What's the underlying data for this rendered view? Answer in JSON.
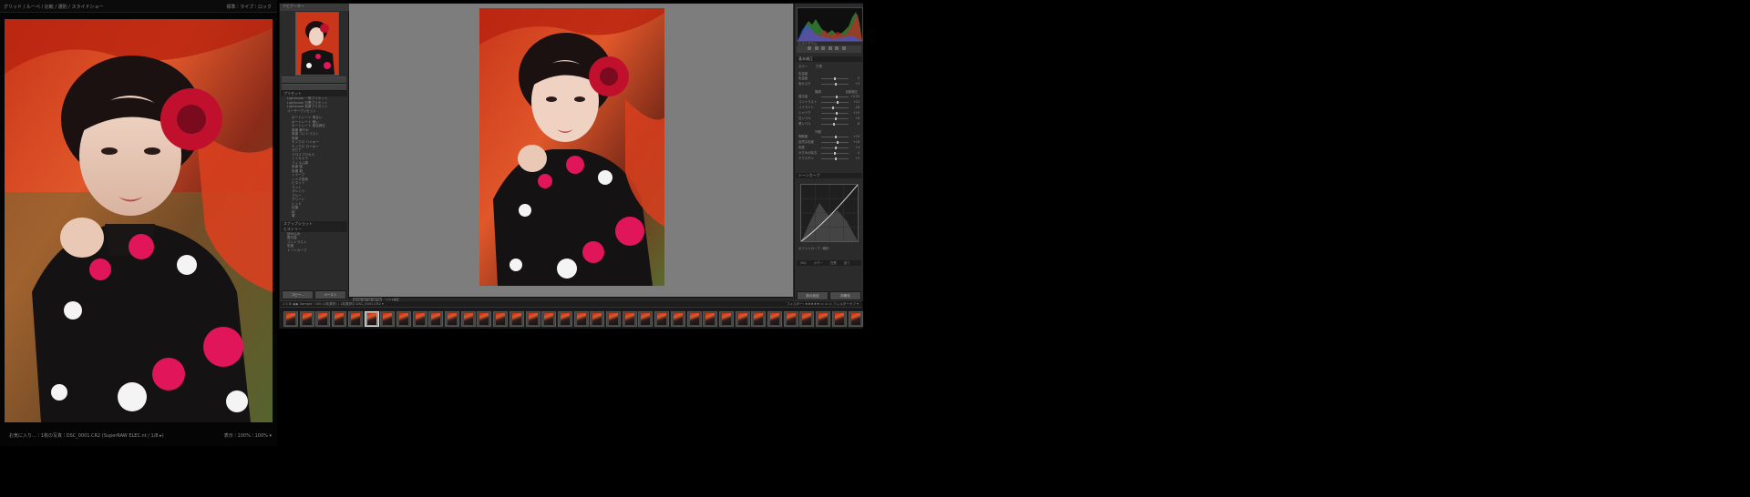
{
  "secondary": {
    "top_left": "グリッド / ルーペ / 比較 / 選別 / スライドショー",
    "top_right": "標準 ⁝ ライブ ⁝ ロック",
    "bottom_left": "お気に入り… ⁝ 1枚の写真 ⁝ DSC_0001.CR2 (SuperRAW ELEC.nt / 1/8 ▸)",
    "bottom_right": "表示 ⁝ 100% ⁝ 100% ▾"
  },
  "left_panel": {
    "header": "ナビゲーター",
    "presets_header": "プリセット",
    "buttons": {
      "copy": "コピー...",
      "paste": "ペースト"
    },
    "preset_folders": [
      "Lightroom 一般プリセット",
      "Lightroom 白黒プリセット",
      "Lightroom 効果プリセット",
      "ユーザープリセット"
    ],
    "preset_items": [
      "ポートレート 明るい",
      "ポートレート 暗い",
      "ポートレート 肌色補正",
      "風景 鮮やか",
      "風景 コントラスト",
      "夜景",
      "モノクロ ハイキー",
      "モノクロ ローキー",
      "セピア",
      "クロスプロセス",
      "トイカメラ",
      "フィルム調",
      "彩度 強",
      "彩度 弱",
      "シャープ",
      "ノイズ低減",
      "ビネット",
      "マット",
      "オレンジ",
      "ブルー",
      "グリーン",
      "レッド",
      "紅葉",
      "桜",
      "雪"
    ],
    "snapshots_header": "スナップショット",
    "history_header": "ヒストリー",
    "history_items": [
      "読み込み",
      "露光量",
      "コントラスト",
      "彩度",
      "トーンカーブ"
    ],
    "bottom_buttons": {
      "copy": "コピー...",
      "paste": "ペースト"
    }
  },
  "center": {
    "toolbar": [
      "□",
      "YY",
      "▭",
      "ソフト校正"
    ]
  },
  "right_panel": {
    "histogram_label": "ヒストグラム",
    "basic_header": "基本補正",
    "treatment": [
      "カラー",
      "白黒"
    ],
    "wb_label": "色温度",
    "tone_header": "階調",
    "tone_auto": "自動補正",
    "sliders": [
      {
        "label": "色温度",
        "pos": 0.5,
        "value": "0"
      },
      {
        "label": "色かぶり",
        "pos": 0.52,
        "value": "+3"
      },
      {
        "label": "露光量",
        "pos": 0.56,
        "value": "+0.35"
      },
      {
        "label": "コントラスト",
        "pos": 0.6,
        "value": "+12"
      },
      {
        "label": "ハイライト",
        "pos": 0.42,
        "value": "-18"
      },
      {
        "label": "シャドウ",
        "pos": 0.58,
        "value": "+15"
      },
      {
        "label": "白レベル",
        "pos": 0.54,
        "value": "+6"
      },
      {
        "label": "黒レベル",
        "pos": 0.46,
        "value": "-8"
      }
    ],
    "presence_header": "外観",
    "presence_sliders": [
      {
        "label": "明瞭度",
        "pos": 0.55,
        "value": "+10"
      },
      {
        "label": "自然な彩度",
        "pos": 0.6,
        "value": "+18"
      },
      {
        "label": "彩度",
        "pos": 0.52,
        "value": "+4"
      },
      {
        "label": "かすみの除去",
        "pos": 0.5,
        "value": "0"
      },
      {
        "label": "テクスチャ",
        "pos": 0.53,
        "value": "+5"
      }
    ],
    "curve_header": "トーンカーブ",
    "curve_footer": "ポイントカーブ ⁝ 線形",
    "tabs": [
      "HSL",
      "カラー",
      "白黒",
      "全て"
    ],
    "bottom_buttons": {
      "prev": "前の設定",
      "reset": "初期化"
    }
  },
  "filmstrip": {
    "header_left": "1  2   ⊞  ◀ ▶   Sample ⁝ 100 (1枚選択) / 1枚選択中 DSC_0001.CR2 ▾",
    "header_right": "フィルター: ★★★★★ ▭ ▭ ▭  フィルターオフ ▾",
    "thumb_count": 36,
    "selected_index": 5
  }
}
